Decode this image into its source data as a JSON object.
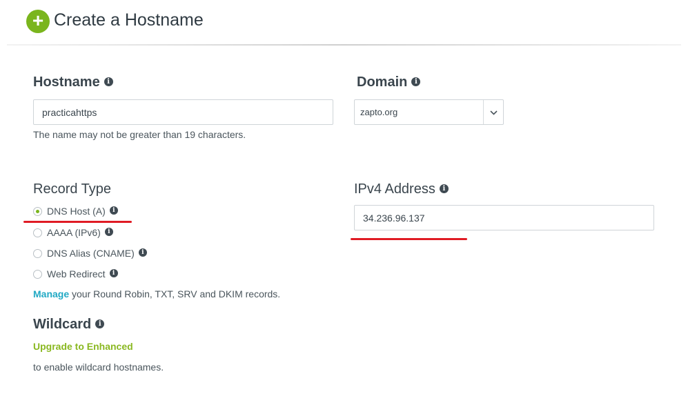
{
  "header": {
    "icon": "plus-circle-icon",
    "title": "Create a Hostname"
  },
  "hostname": {
    "label": "Hostname",
    "value": "practicahttps",
    "help": "The name may not be greater than 19 characters."
  },
  "domain": {
    "label": "Domain",
    "selected": "zapto.org"
  },
  "record_type": {
    "label": "Record Type",
    "options": [
      {
        "label": "DNS Host (A)",
        "checked": true
      },
      {
        "label": "AAAA (IPv6)",
        "checked": false
      },
      {
        "label": "DNS Alias (CNAME)",
        "checked": false
      },
      {
        "label": "Web Redirect",
        "checked": false
      }
    ],
    "manage_link": "Manage",
    "manage_text": " your Round Robin, TXT, SRV and DKIM records."
  },
  "ipv4": {
    "label": "IPv4 Address",
    "value": "34.236.96.137"
  },
  "wildcard": {
    "label": "Wildcard",
    "upgrade_link": "Upgrade to Enhanced",
    "help": "to enable wildcard hostnames."
  },
  "info_glyph": "i",
  "colors": {
    "accent_green": "#7ab51d",
    "link_teal": "#21a9c4",
    "link_green": "#8ab821",
    "annotation_red": "#e01b24"
  }
}
